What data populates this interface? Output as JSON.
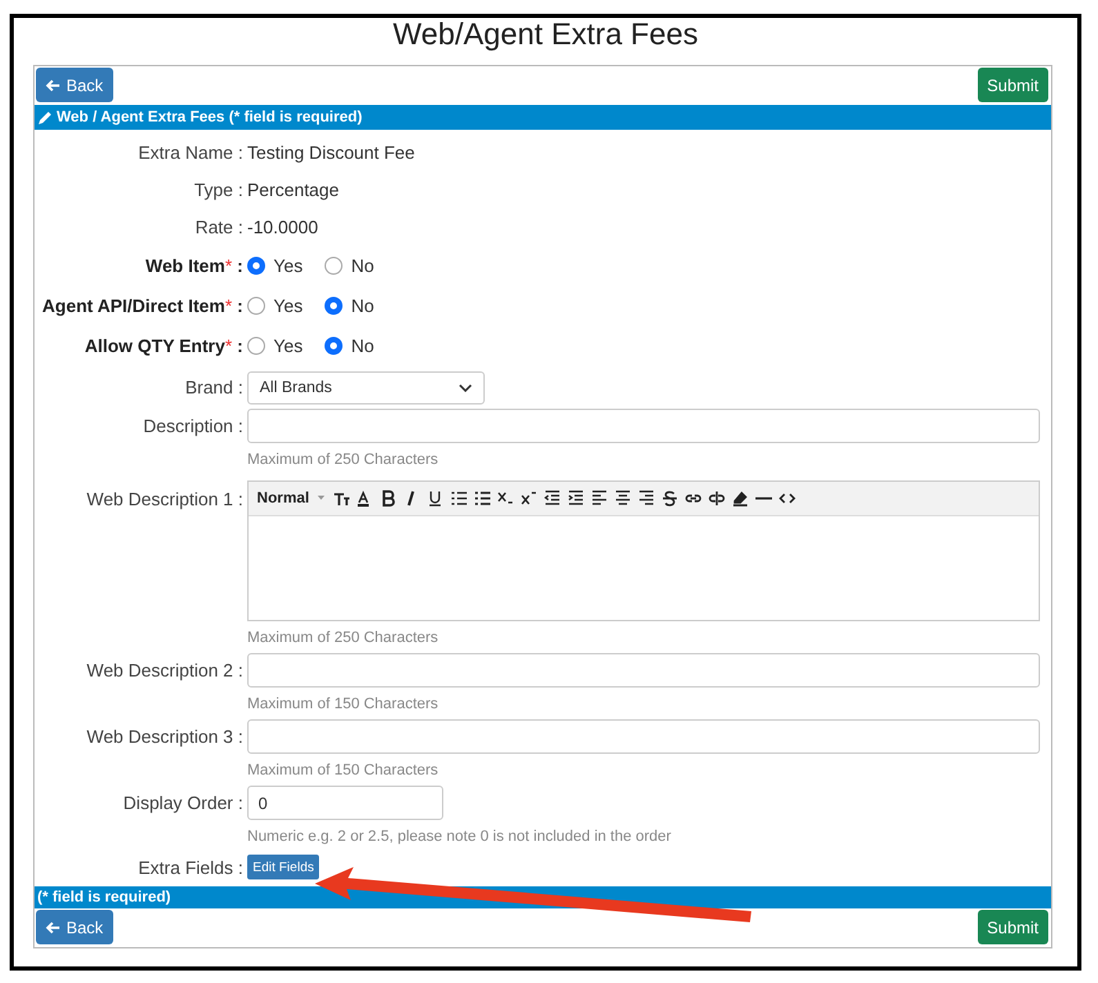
{
  "title": "Web/Agent Extra Fees",
  "top_buttons": [
    {
      "label": "Back",
      "kind": "back"
    },
    {
      "label": "Submit",
      "kind": "submit"
    }
  ],
  "section_header": "Web / Agent Extra Fees (* field is required)",
  "info_rows": [
    {
      "label": "Extra Name :",
      "value": "Testing Discount Fee"
    },
    {
      "label": "Type :",
      "value": "Percentage"
    },
    {
      "label": "Rate :",
      "value": "-10.0000"
    }
  ],
  "radio_rows": [
    {
      "label": "Web Item",
      "required": true,
      "required_mark": "*",
      "colon": ":",
      "options": [
        {
          "label": "Yes",
          "selected": true
        },
        {
          "label": "No",
          "selected": false
        }
      ]
    },
    {
      "label": "Agent API/Direct Item",
      "required": true,
      "required_mark": "*",
      "colon": ":",
      "options": [
        {
          "label": "Yes",
          "selected": false
        },
        {
          "label": "No",
          "selected": true
        }
      ]
    },
    {
      "label": "Allow QTY Entry",
      "required": true,
      "required_mark": "*",
      "colon": ":",
      "options": [
        {
          "label": "Yes",
          "selected": false
        },
        {
          "label": "No",
          "selected": true
        }
      ]
    }
  ],
  "brand": {
    "label": "Brand :",
    "value": "All Brands"
  },
  "fields": [
    {
      "label": "Description :",
      "kind": "input",
      "hint": "Maximum of 250 Characters"
    },
    {
      "label": "Web Description 1 :",
      "kind": "editor",
      "format": "Normal",
      "hint": "Maximum of 250 Characters"
    },
    {
      "label": "Web Description 2 :",
      "kind": "input",
      "hint": "Maximum of 150 Characters"
    },
    {
      "label": "Web Description 3 :",
      "kind": "input",
      "hint": "Maximum of 150 Characters"
    },
    {
      "label": "Display Order :",
      "kind": "short",
      "value": "0",
      "hint": "Numeric e.g. 2 or 2.5, please note 0 is not included in the order"
    }
  ],
  "extra_fields": {
    "label": "Extra Fields :",
    "button": "Edit Fields"
  },
  "footer_note": "(* field is required)",
  "bottom_buttons": [
    {
      "label": "Back",
      "kind": "back"
    },
    {
      "label": "Submit",
      "kind": "submit"
    }
  ]
}
